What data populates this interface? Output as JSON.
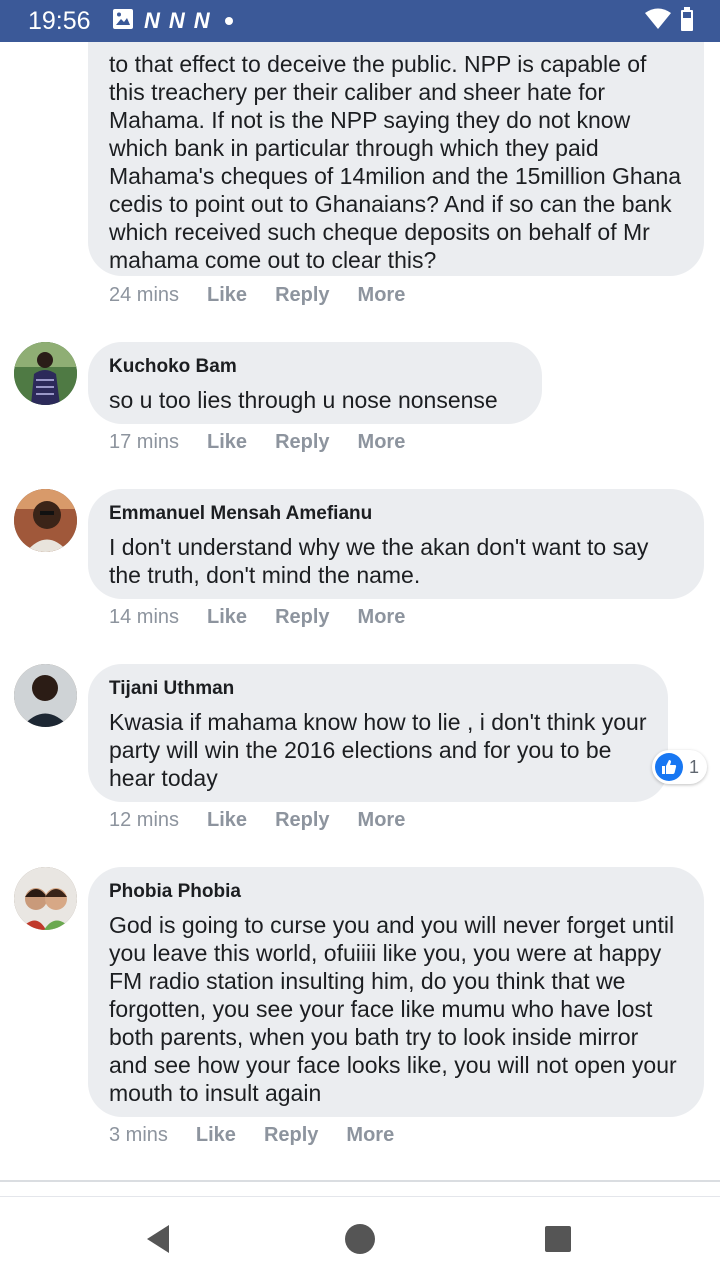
{
  "status_bar": {
    "time": "19:56",
    "left_icons": [
      "image-icon",
      "n-notification-icon",
      "n-notification-icon",
      "n-notification-icon",
      "dot-icon"
    ],
    "n_glyph": "N",
    "right_icons": [
      "wifi-icon",
      "battery-icon"
    ],
    "background": "#3b5998"
  },
  "comments": [
    {
      "author": "",
      "text": "to that effect to deceive the public. NPP is capable of this treachery per their caliber and sheer hate for Mahama. If not is the NPP saying they do not know which bank in particular through which they paid Mahama's cheques of 14milion and the 15million Ghana cedis to point out to Ghanaians? And if so can the bank which received such cheque deposits on behalf of Mr mahama come out to clear this?",
      "time": "24 mins",
      "like": "Like",
      "reply": "Reply",
      "more": "More"
    },
    {
      "author": "Kuchoko Bam",
      "text": "so u too lies through u nose nonsense",
      "time": "17 mins",
      "like": "Like",
      "reply": "Reply",
      "more": "More"
    },
    {
      "author": "Emmanuel Mensah Amefianu",
      "text": "I don't understand why we the akan don't want to say the truth, don't mind the name.",
      "time": "14 mins",
      "like": "Like",
      "reply": "Reply",
      "more": "More"
    },
    {
      "author": "Tijani Uthman",
      "text": "Kwasia if mahama know how to lie , i don't think your party will win the 2016 elections and for you to be hear today",
      "time": "12 mins",
      "like": "Like",
      "reply": "Reply",
      "more": "More",
      "reaction_count": "1"
    },
    {
      "author": "Phobia Phobia",
      "text": "God is going to curse you and you will never forget until you leave this world, ofuiiii like you, you were at happy FM radio station insulting him, do you think that we forgotten, you see your face like mumu who have lost both parents, when you bath try to look inside mirror and see how your face looks like, you will not open your mouth to insult again",
      "time": "3 mins",
      "like": "Like",
      "reply": "Reply",
      "more": "More"
    }
  ],
  "nav_bar": {
    "buttons": [
      "back-icon",
      "home-icon",
      "recents-icon"
    ]
  },
  "colors": {
    "bubble": "#ebedf0",
    "meta_text": "#8d949e",
    "like_blue": "#1877f2"
  }
}
